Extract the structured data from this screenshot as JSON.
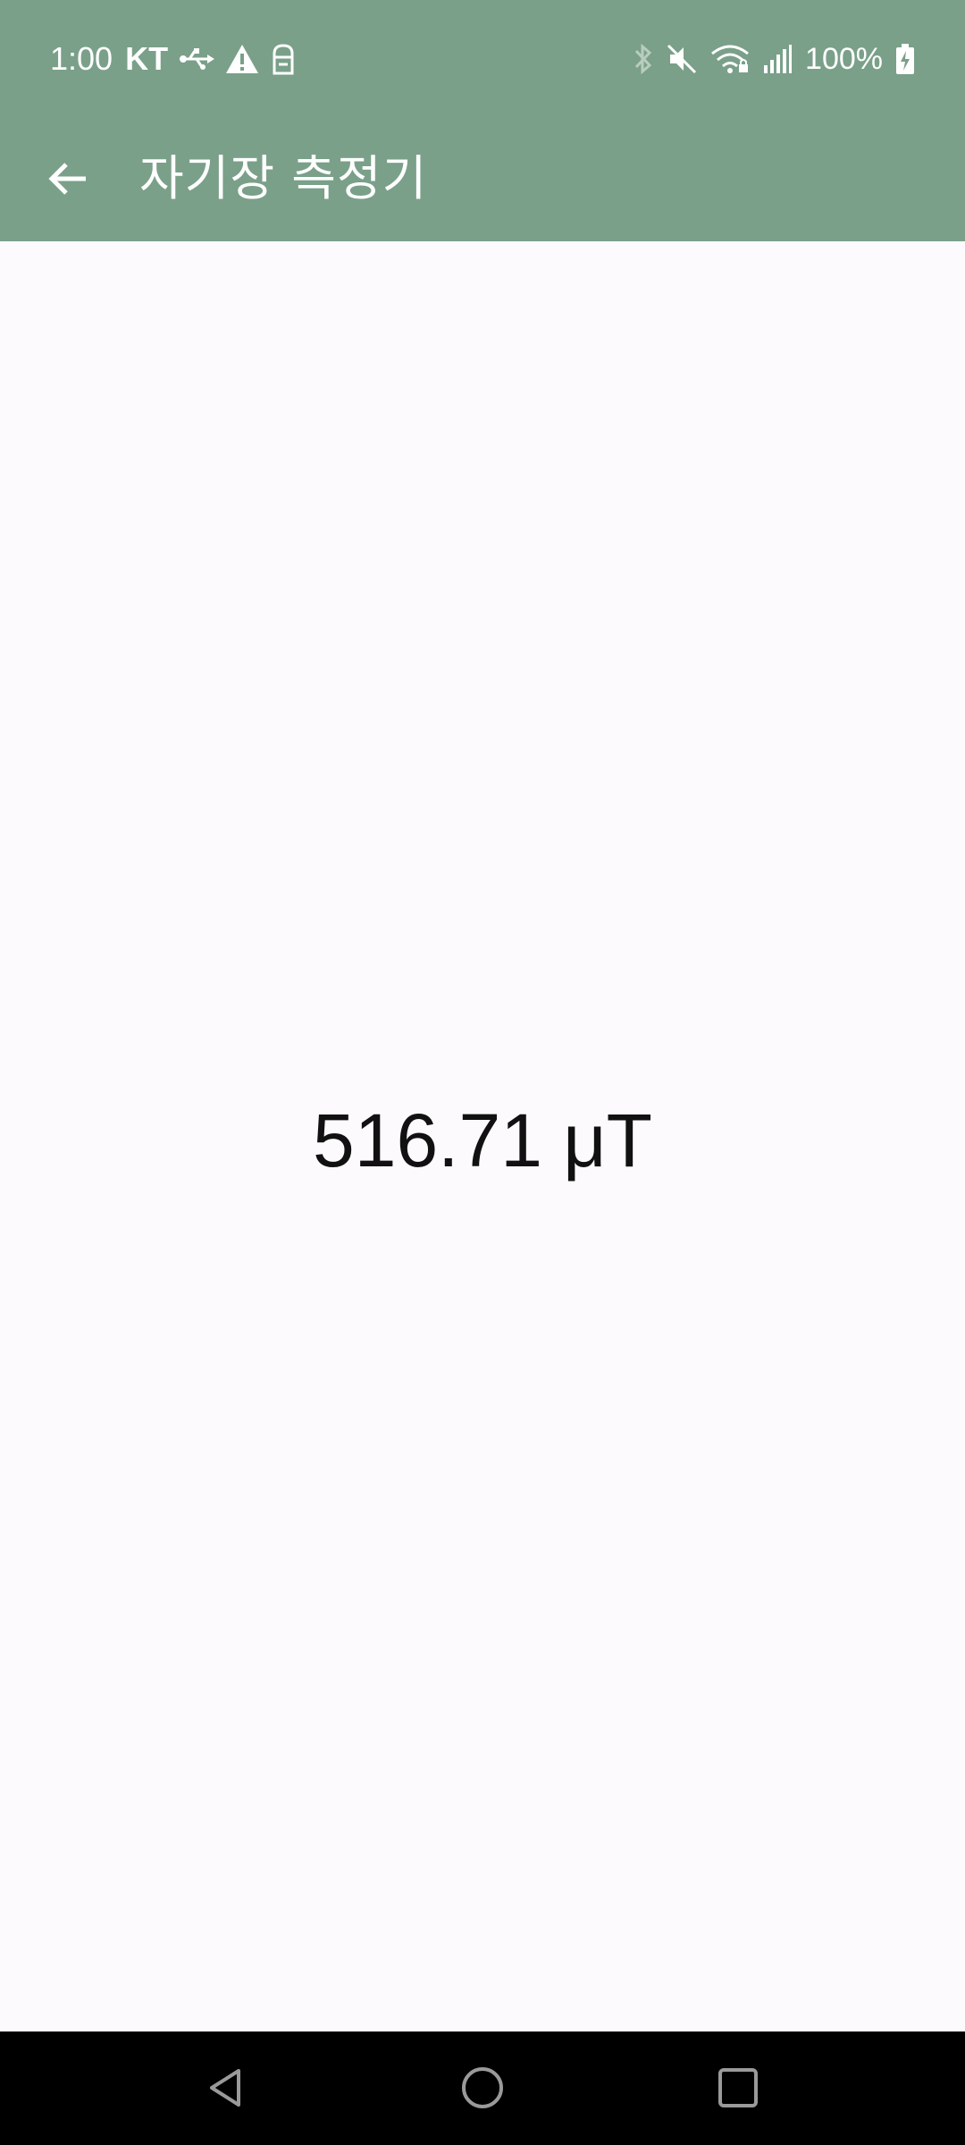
{
  "status_bar": {
    "time": "1:00",
    "carrier": "KT",
    "battery": "100%",
    "icons_left": [
      "usb-icon",
      "warning-icon",
      "ghost-icon"
    ],
    "icons_right": [
      "bluetooth-icon",
      "mute-icon",
      "wifi-icon",
      "signal-icon",
      "battery-icon"
    ]
  },
  "app_bar": {
    "title": "자기장 측정기",
    "back_icon": "arrow-left-icon",
    "background_color": "#7aa089"
  },
  "content": {
    "reading": "516.71 μT"
  },
  "nav_bar": {
    "buttons": [
      "back-triangle-icon",
      "home-circle-icon",
      "recents-square-icon"
    ]
  }
}
